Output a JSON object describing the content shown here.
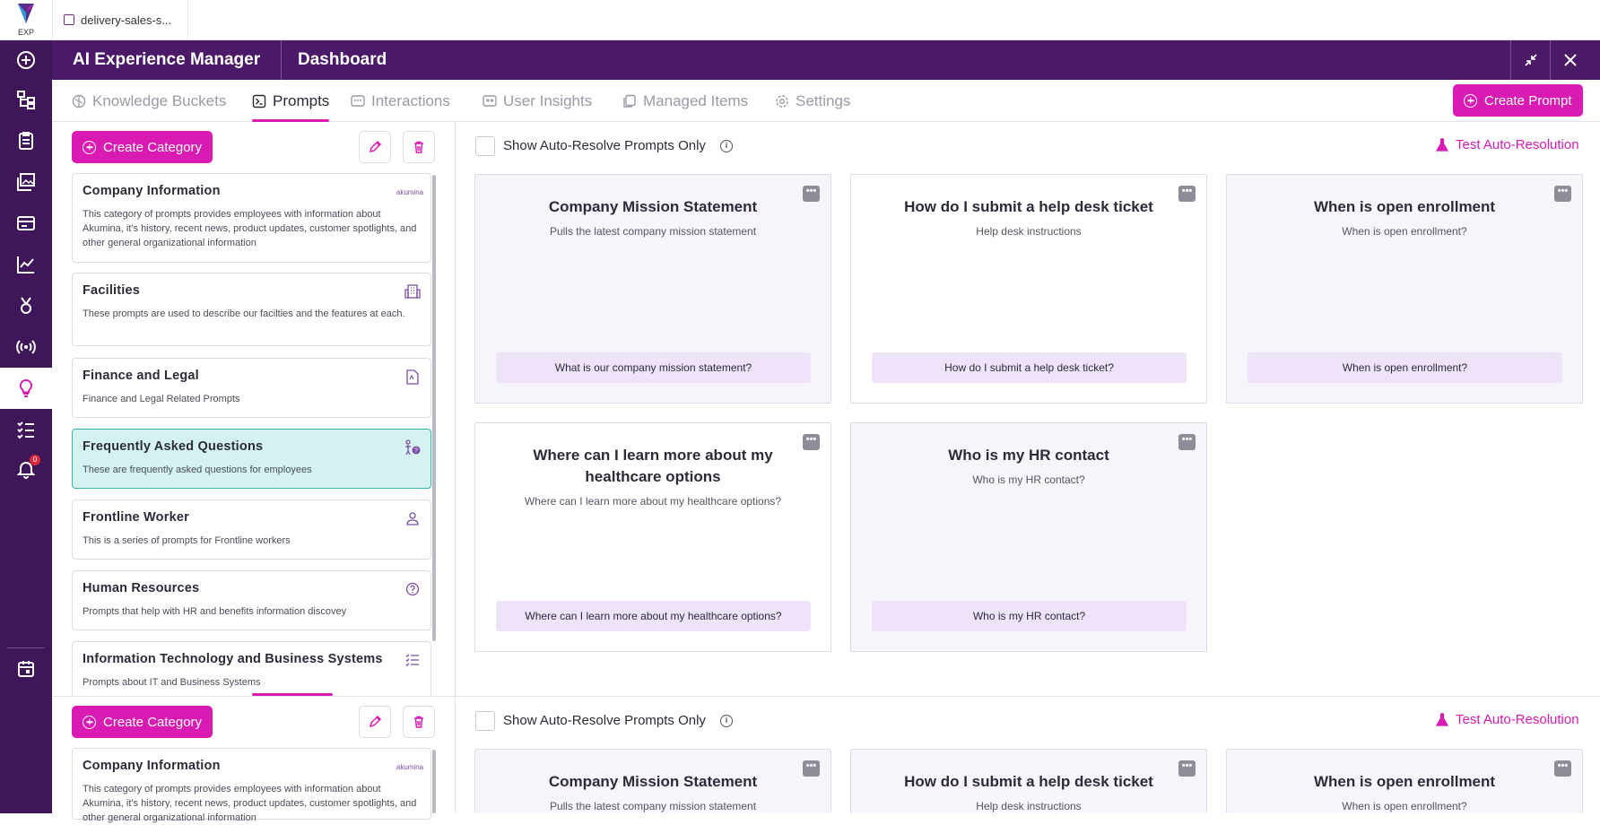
{
  "browser": {
    "logo_label": "EXP",
    "tab_label": "delivery-sales-s..."
  },
  "appbar": {
    "title": "AI Experience Manager",
    "section": "Dashboard"
  },
  "sidebar": {
    "notification_count": "0"
  },
  "tabs": [
    {
      "label": "Knowledge Buckets",
      "icon": "brain-icon"
    },
    {
      "label": "Prompts",
      "icon": "terminal-icon"
    },
    {
      "label": "Interactions",
      "icon": "chat-icon"
    },
    {
      "label": "User Insights",
      "icon": "users-icon"
    },
    {
      "label": "Managed Items",
      "icon": "copy-icon"
    },
    {
      "label": "Settings",
      "icon": "gear-icon"
    }
  ],
  "create_prompt_label": "Create Prompt",
  "create_category_label": "Create Category",
  "show_auto_resolve_label": "Show Auto-Resolve Prompts Only",
  "test_auto_resolution_label": "Test Auto-Resolution",
  "categories": [
    {
      "title": "Company Information",
      "desc": "This category of prompts provides employees with information about Akumina, it's history, recent news, product updates, customer spotlights, and other general organizational information",
      "icon": "akumina-logo"
    },
    {
      "title": "Facilities",
      "desc": "These prompts are used to describe our facilties and the features at each.",
      "icon": "building-icon"
    },
    {
      "title": "Finance and Legal",
      "desc": "Finance and Legal Related Prompts",
      "icon": "document-icon"
    },
    {
      "title": "Frequently Asked Questions",
      "desc": "These are frequently asked questions for employees",
      "icon": "person-question-icon"
    },
    {
      "title": "Frontline Worker",
      "desc": "This is a series of prompts for Frontline workers",
      "icon": "worker-icon"
    },
    {
      "title": "Human Resources",
      "desc": "Prompts that help with HR and benefits information discovey",
      "icon": "help-circle-icon"
    },
    {
      "title": "Information Technology and Business Systems",
      "desc": "Prompts about IT and Business Systems",
      "icon": "checklist-icon"
    }
  ],
  "akumina_logo_text": "akumina",
  "prompts": [
    {
      "title": "Company Mission Statement",
      "subtitle": "Pulls the latest company mission statement",
      "question": "What is our company mission statement?"
    },
    {
      "title": "How do I submit a help desk ticket",
      "subtitle": "Help desk instructions",
      "question": "How do I submit a help desk ticket?"
    },
    {
      "title": "When is open enrollment",
      "subtitle": "When is open enrollment?",
      "question": "When is open enrollment?"
    },
    {
      "title": "Where can I learn more about my healthcare options",
      "subtitle": "Where can I learn more about my healthcare options?",
      "question": "Where can I learn more about my healthcare options?"
    },
    {
      "title": "Who is my HR contact",
      "subtitle": "Who is my HR contact?",
      "question": "Who is my HR contact?"
    }
  ],
  "more_label": "•••",
  "info_label": "i",
  "colors": {
    "brand_purple": "#4a1968",
    "sidebar_purple": "#3f1659",
    "accent_pink": "#d91bb4",
    "selected_teal": "#d4f3f0"
  }
}
